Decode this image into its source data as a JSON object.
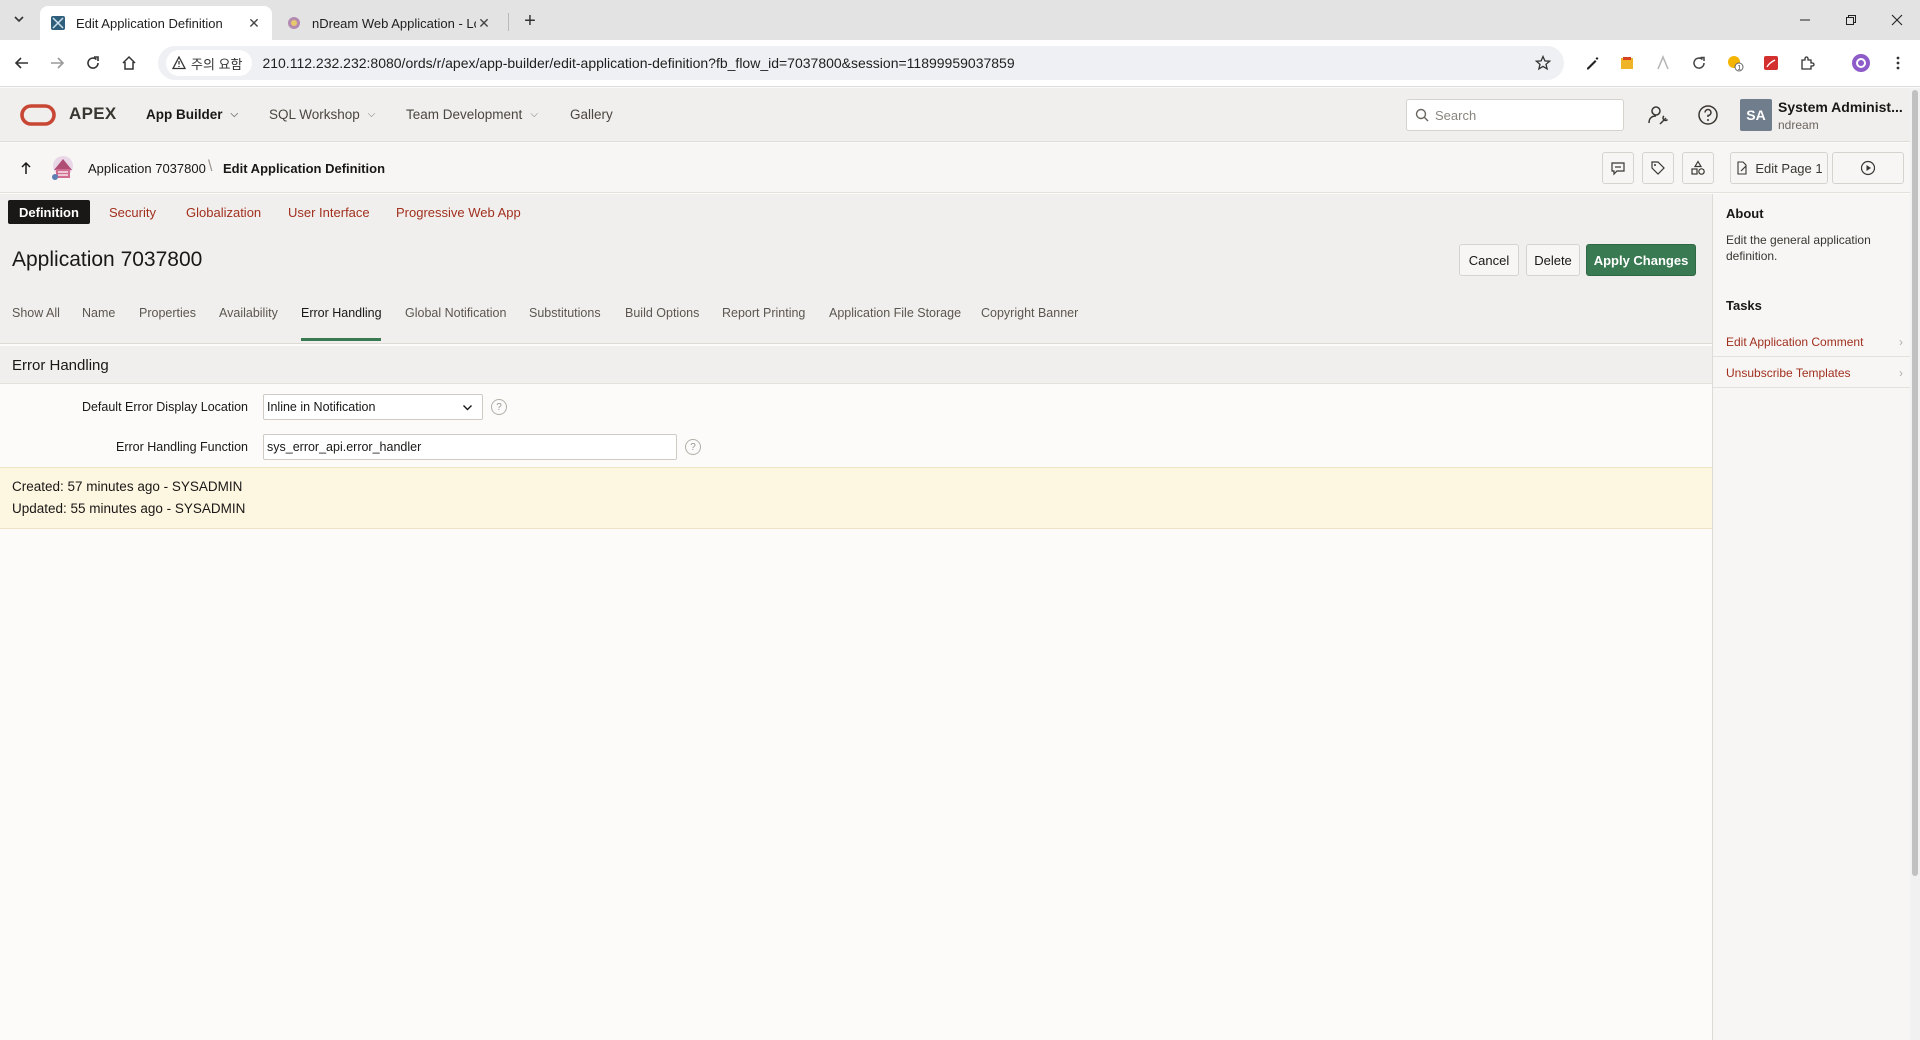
{
  "browser": {
    "tabs": [
      {
        "title": "Edit Application Definition",
        "active": true
      },
      {
        "title": "nDream Web Application - Lo",
        "active": false
      }
    ],
    "security_chip": "주의 요함",
    "url": "210.112.232.232:8080/ords/r/apex/app-builder/edit-application-definition?fb_flow_id=7037800&session=11899959037859"
  },
  "header": {
    "brand": "APEX",
    "menus": [
      "App Builder",
      "SQL Workshop",
      "Team Development",
      "Gallery"
    ],
    "search_placeholder": "Search",
    "user": {
      "initials": "SA",
      "name": "System Administ...",
      "workspace": "ndream"
    }
  },
  "breadcrumb": {
    "app": "Application 7037800",
    "current": "Edit Application Definition",
    "edit_page_label": "Edit Page 1"
  },
  "section_tabs": [
    "Definition",
    "Security",
    "Globalization",
    "User Interface",
    "Progressive Web App"
  ],
  "page": {
    "title": "Application 7037800",
    "buttons": {
      "cancel": "Cancel",
      "delete": "Delete",
      "apply": "Apply Changes"
    },
    "sub_tabs": [
      "Show All",
      "Name",
      "Properties",
      "Availability",
      "Error Handling",
      "Global Notification",
      "Substitutions",
      "Build Options",
      "Report Printing",
      "Application File Storage",
      "Copyright Banner"
    ],
    "active_sub_tab": "Error Handling"
  },
  "region": {
    "title": "Error Handling",
    "fields": [
      {
        "label": "Default Error Display Location",
        "value": "Inline in Notification"
      },
      {
        "label": "Error Handling Function",
        "value": "sys_error_api.error_handler"
      }
    ]
  },
  "audit": {
    "created": "Created: 57 minutes ago - SYSADMIN",
    "updated": "Updated: 55 minutes ago - SYSADMIN"
  },
  "sidebar": {
    "about_title": "About",
    "about_text": "Edit the general application definition.",
    "tasks_title": "Tasks",
    "tasks": [
      "Edit Application Comment",
      "Unsubscribe Templates"
    ]
  },
  "colors": {
    "accent": "#3a7a52",
    "link": "#a1301f",
    "oracle_red": "#c74634"
  }
}
